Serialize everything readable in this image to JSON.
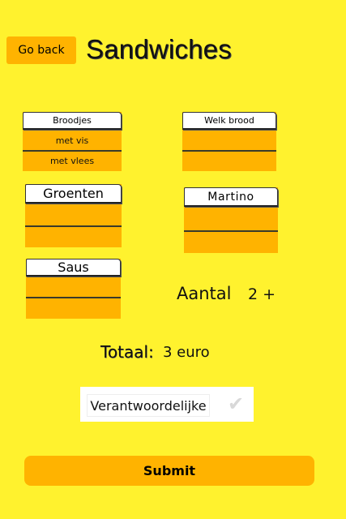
{
  "header": {
    "back_label": "Go back",
    "title": "Sandwiches"
  },
  "dropdowns": {
    "broodjes": {
      "label": "Broodjes",
      "options": [
        "met vis",
        "met vlees"
      ]
    },
    "welk_brood": {
      "label": "Welk brood"
    },
    "groenten": {
      "label": "Groenten"
    },
    "martino": {
      "label": "Martino"
    },
    "saus": {
      "label": "Saus"
    }
  },
  "aantal": {
    "label": "Aantal",
    "value": "2 +"
  },
  "totaal": {
    "label": "Totaal:",
    "value": "3 euro"
  },
  "verantwoordelijke": {
    "label": "Verantwoordelijke",
    "check_icon": "checkmark-icon",
    "checked": false
  },
  "submit_label": "Submit",
  "colors": {
    "background": "#fff22e",
    "accent": "#ffb300"
  }
}
